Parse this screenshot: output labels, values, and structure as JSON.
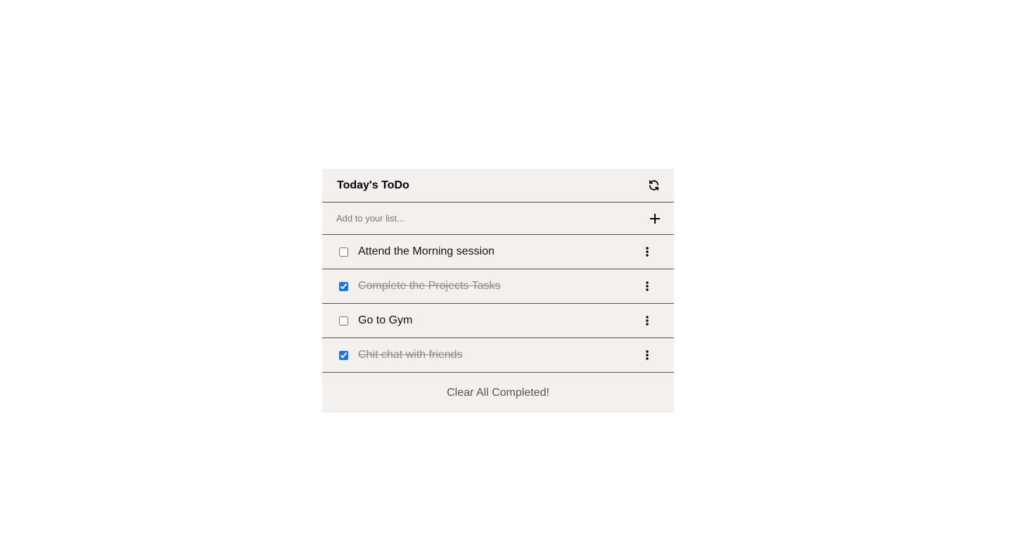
{
  "header": {
    "title": "Today's ToDo",
    "refresh_icon": "refresh-icon"
  },
  "add": {
    "placeholder": "Add to your list...",
    "value": "",
    "add_icon": "plus-icon"
  },
  "tasks": [
    {
      "label": "Attend the Morning session",
      "completed": false
    },
    {
      "label": "Complete the Projects Tasks",
      "completed": true
    },
    {
      "label": "Go to Gym",
      "completed": false
    },
    {
      "label": "Chit chat with friends",
      "completed": true
    }
  ],
  "footer": {
    "clear_label": "Clear All Completed!"
  },
  "colors": {
    "card_background": "#f3f0ef",
    "divider": "#555555",
    "completed_text": "#8a8a8a",
    "checkbox_accent": "#1a73e8"
  }
}
